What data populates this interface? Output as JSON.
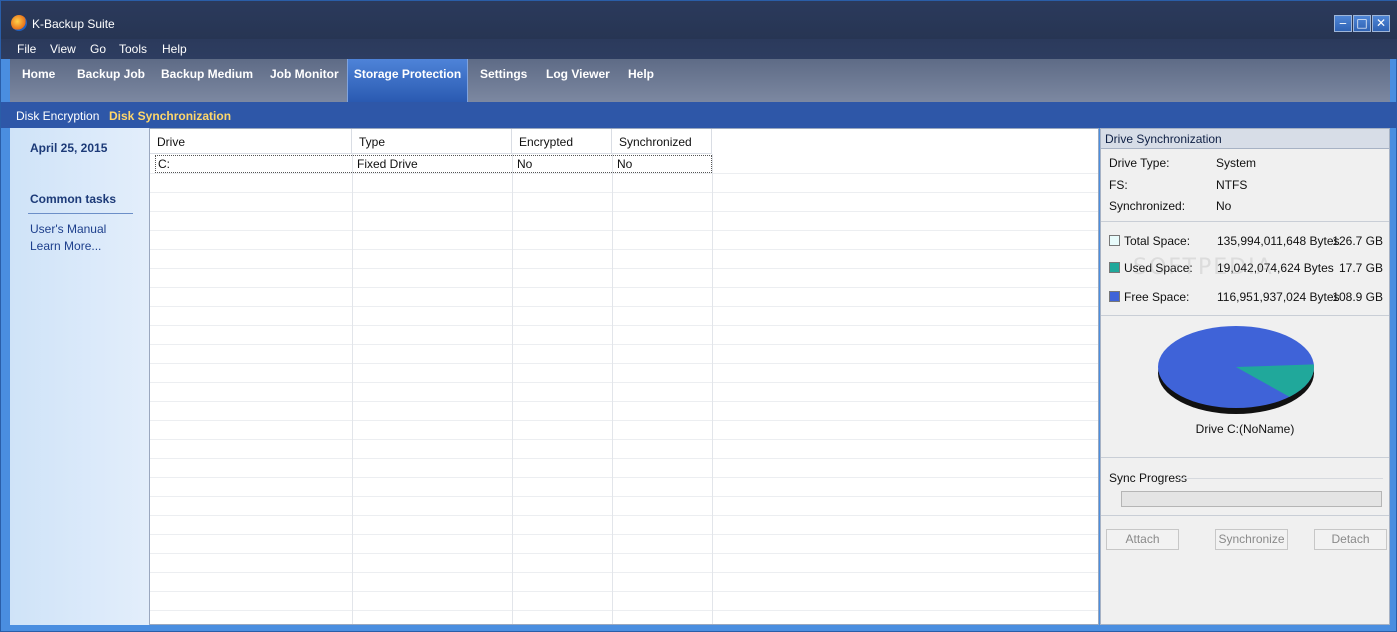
{
  "window": {
    "title": "K-Backup Suite"
  },
  "menu": [
    "File",
    "View",
    "Go",
    "Tools",
    "Help"
  ],
  "tabs": [
    "Home",
    "Backup Job",
    "Backup Medium",
    "Job Monitor",
    "Storage Protection",
    "Settings",
    "Log Viewer",
    "Help"
  ],
  "active_tab": "Storage Protection",
  "subtabs": [
    "Disk Encryption",
    "Disk Synchronization"
  ],
  "active_subtab": "Disk Synchronization",
  "sidebar": {
    "date": "April 25, 2015",
    "common_tasks": "Common tasks",
    "links": [
      "User's Manual",
      "Learn More..."
    ]
  },
  "grid": {
    "columns": [
      "Drive",
      "Type",
      "Encrypted",
      "Synchronized"
    ],
    "rows": [
      [
        "C:",
        "Fixed Drive",
        "No",
        "No"
      ]
    ]
  },
  "panel": {
    "header": "Drive Synchronization",
    "drive_type_label": "Drive Type:",
    "drive_type": "System",
    "fs_label": "FS:",
    "fs": "NTFS",
    "synchronized_label": "Synchronized:",
    "synchronized": "No",
    "total_label": "Total Space:",
    "total_bytes": "135,994,011,648 Bytes",
    "total_gb": "126.7 GB",
    "used_label": "Used Space:",
    "used_bytes": "19,042,074,624 Bytes",
    "used_gb": "17.7 GB",
    "free_label": "Free Space:",
    "free_bytes": "116,951,937,024 Bytes",
    "free_gb": "108.9 GB",
    "chart_caption": "Drive C:(NoName)",
    "sync_progress_label": "Sync Progress",
    "sync_progress": 0,
    "buttons": {
      "attach": "Attach",
      "synchronize": "Synchronize",
      "detach": "Detach"
    }
  },
  "colors": {
    "total_swatch": "#e8fbfb",
    "used_swatch": "#20a89b",
    "free_swatch": "#3f63d8"
  },
  "watermark": "SOFTPEDIA"
}
